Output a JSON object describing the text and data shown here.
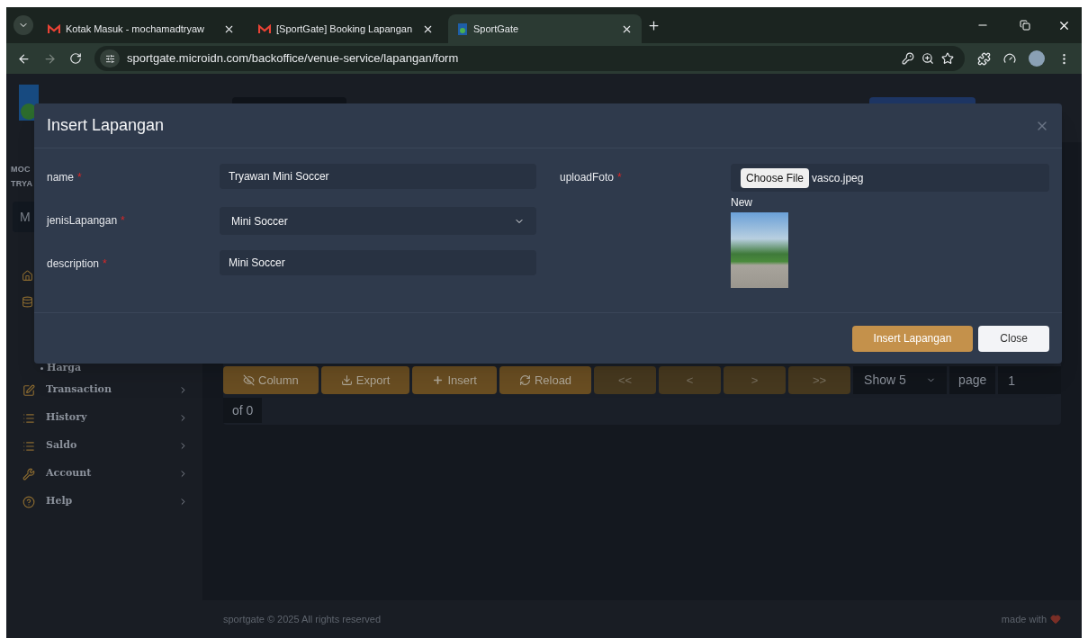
{
  "browser": {
    "tabs": [
      {
        "title": "Kotak Masuk - mochamadtryaw",
        "kind": "mail",
        "selected": false
      },
      {
        "title": "[SportGate] Booking Lapangan",
        "kind": "mail",
        "selected": false
      },
      {
        "title": "SportGate",
        "kind": "site",
        "selected": true
      }
    ],
    "url": "sportgate.microidn.com/backoffice/venue-service/lapangan/form"
  },
  "sidebar": {
    "user_lines": [
      "MOC",
      "TRYA"
    ],
    "box_text": "M",
    "subitems": [
      "Harga"
    ],
    "items": [
      {
        "label": "Transaction",
        "kind": "edit"
      },
      {
        "label": "History",
        "kind": "list"
      },
      {
        "label": "Saldo",
        "kind": "list"
      },
      {
        "label": "Account",
        "kind": "key"
      },
      {
        "label": "Help",
        "kind": "help"
      }
    ]
  },
  "toolbar": {
    "buttons": [
      {
        "label": "Column",
        "kind": "column",
        "disabled": false
      },
      {
        "label": "Export",
        "kind": "export",
        "disabled": false
      },
      {
        "label": "Insert",
        "kind": "insert",
        "disabled": false
      },
      {
        "label": "Reload",
        "kind": "reload",
        "disabled": false
      },
      {
        "label": "<<",
        "kind": "plain",
        "disabled": true
      },
      {
        "label": "<",
        "kind": "plain",
        "disabled": true
      },
      {
        "label": ">",
        "kind": "plain",
        "disabled": true
      },
      {
        "label": ">>",
        "kind": "plain",
        "disabled": true
      }
    ],
    "page_size": "Show 5",
    "page_label": "page",
    "page_value": "1",
    "total": "of 0"
  },
  "modal": {
    "title": "Insert Lapangan",
    "fields": [
      {
        "label": "name",
        "required_mark": "*",
        "kind": "text",
        "value": "Tryawan Mini Soccer"
      },
      {
        "label": "jenisLapangan",
        "required_mark": "*",
        "kind": "select",
        "value": "Mini Soccer"
      },
      {
        "label": "description",
        "required_mark": "*",
        "kind": "text",
        "value": "Mini Soccer"
      }
    ],
    "upload": {
      "label": "uploadFoto",
      "required_mark": "*",
      "button": "Choose File",
      "file": "vasco.jpeg",
      "preview_label": "New"
    },
    "buttons": [
      {
        "label": "Insert Lapangan",
        "kind": "primary"
      },
      {
        "label": "Close",
        "kind": "secondary"
      }
    ]
  },
  "footer": {
    "copyright": "sportgate © 2025 All rights reserved",
    "made_with": "made with"
  }
}
